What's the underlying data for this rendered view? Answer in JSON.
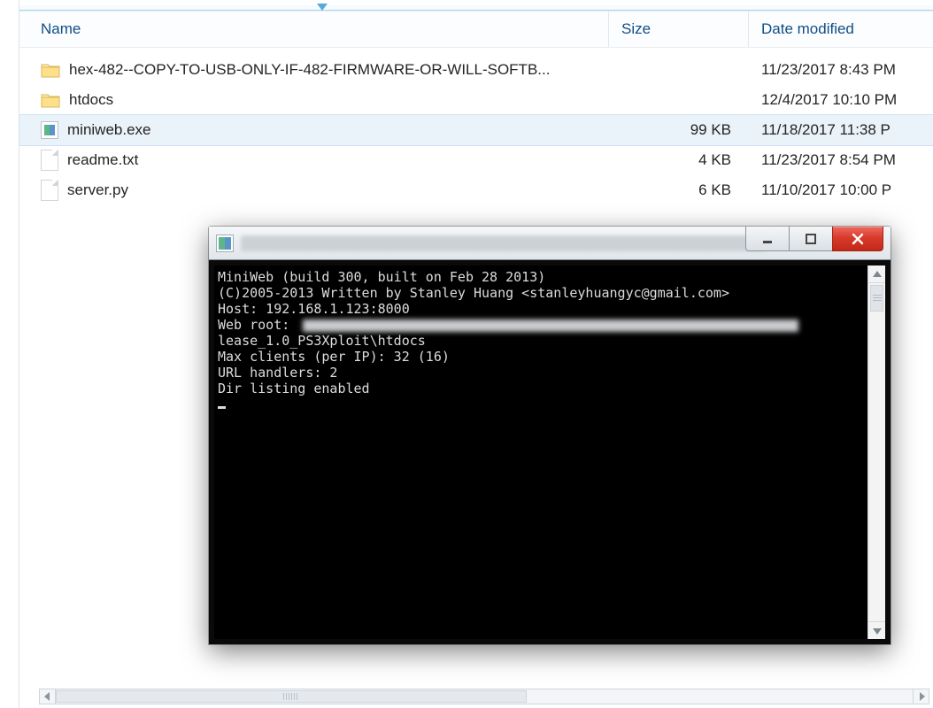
{
  "explorer": {
    "columns": {
      "name": "Name",
      "size": "Size",
      "date": "Date modified"
    },
    "rows": [
      {
        "type": "folder",
        "name": "hex-482--COPY-TO-USB-ONLY-IF-482-FIRMWARE-OR-WILL-SOFTB...",
        "size": "",
        "date": "11/23/2017 8:43 PM"
      },
      {
        "type": "folder",
        "name": "htdocs",
        "size": "",
        "date": "12/4/2017 10:10 PM"
      },
      {
        "type": "exe",
        "name": "miniweb.exe",
        "size": "99 KB",
        "date": "11/18/2017 11:38 P",
        "selected": true
      },
      {
        "type": "file",
        "name": "readme.txt",
        "size": "4 KB",
        "date": "11/23/2017 8:54 PM"
      },
      {
        "type": "file",
        "name": "server.py",
        "size": "6 KB",
        "date": "11/10/2017 10:00 P"
      }
    ]
  },
  "console": {
    "lines": [
      "MiniWeb (build 300, built on Feb 28 2013)",
      "(C)2005-2013 Written by Stanley Huang <stanleyhuangyc@gmail.com>",
      "",
      "Host: 192.168.1.123:8000",
      "Web root:",
      "lease_1.0_PS3Xploit\\htdocs",
      "Max clients (per IP): 32 (16)",
      "URL handlers: 2",
      "Dir listing enabled"
    ]
  }
}
